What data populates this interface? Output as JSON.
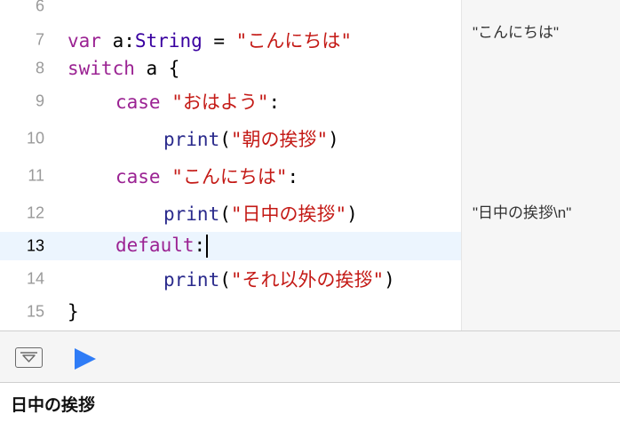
{
  "editor": {
    "current_line": "13",
    "lines": [
      {
        "num": "6"
      },
      {
        "num": "7",
        "kw": "var",
        "name": " a:",
        "type": "String",
        "op": " = ",
        "str": "\"こんにちは\""
      },
      {
        "num": "8",
        "kw": "switch",
        "name": " a {"
      },
      {
        "num": "9",
        "kw": "case",
        "str": "\"おはよう\"",
        "tail": ":"
      },
      {
        "num": "10",
        "fn": "print",
        "open": "(",
        "str": "\"朝の挨拶\"",
        "close": ")"
      },
      {
        "num": "11",
        "kw": "case",
        "str": "\"こんにちは\"",
        "tail": ":"
      },
      {
        "num": "12",
        "fn": "print",
        "open": "(",
        "str": "\"日中の挨拶\"",
        "close": ")"
      },
      {
        "num": "13",
        "kw": "default",
        "tail": ":"
      },
      {
        "num": "14",
        "fn": "print",
        "open": "(",
        "str": "\"それ以外の挨拶\"",
        "close": ")"
      },
      {
        "num": "15",
        "tail": "}"
      }
    ]
  },
  "results": {
    "line7": "\"こんにちは\"",
    "line12": "\"日中の挨拶\\n\""
  },
  "console": {
    "output": "日中の挨拶"
  },
  "icons": {
    "toggle": "triangle-down-in-box-icon",
    "run": "play-icon"
  },
  "colors": {
    "keyword": "#9b2393",
    "type": "#3900a0",
    "string": "#c41a16",
    "function": "#2a2a8c",
    "run_button": "#2f7cf6",
    "current_line_bg": "#ecf5fe"
  }
}
